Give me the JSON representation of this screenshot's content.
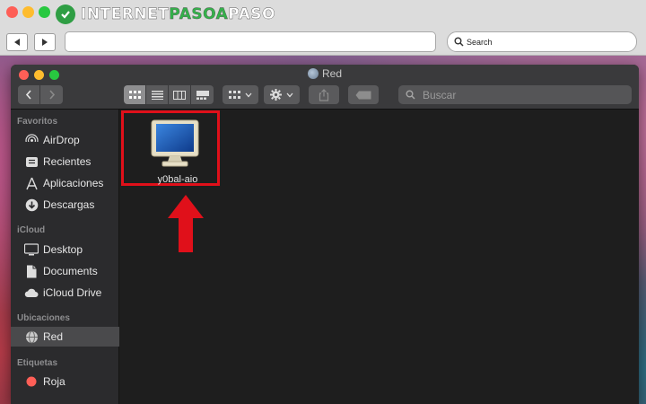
{
  "site": {
    "logo_internet": "INTERNET",
    "logo_paso_a": "PASOA",
    "logo_paso": "PASO"
  },
  "browser": {
    "url": "",
    "search_label": "Search",
    "back_icon": "back-arrow-icon",
    "forward_icon": "forward-arrow-icon"
  },
  "finder": {
    "title": "Red",
    "search_placeholder": "Buscar",
    "view_modes": [
      "icons",
      "list",
      "columns",
      "gallery"
    ],
    "active_view": "icons"
  },
  "sidebar": {
    "sections": [
      {
        "title": "Favoritos",
        "items": [
          {
            "label": "AirDrop",
            "icon": "airdrop-icon"
          },
          {
            "label": "Recientes",
            "icon": "clock-icon"
          },
          {
            "label": "Aplicaciones",
            "icon": "applications-icon"
          },
          {
            "label": "Descargas",
            "icon": "download-icon"
          }
        ]
      },
      {
        "title": "iCloud",
        "items": [
          {
            "label": "Desktop",
            "icon": "desktop-icon"
          },
          {
            "label": "Documents",
            "icon": "document-icon"
          },
          {
            "label": "iCloud Drive",
            "icon": "cloud-icon"
          }
        ]
      },
      {
        "title": "Ubicaciones",
        "items": [
          {
            "label": "Red",
            "icon": "network-globe-icon",
            "selected": true
          }
        ]
      },
      {
        "title": "Etiquetas",
        "items": [
          {
            "label": "Roja",
            "icon": "red-tag-icon"
          }
        ]
      }
    ]
  },
  "content": {
    "files": [
      {
        "name": "y0bal-aio",
        "icon": "computer-monitor-icon",
        "highlighted": true
      }
    ]
  },
  "colors": {
    "highlight": "#e0101a",
    "arrow": "#e0101a",
    "finder_bg": "#1e1e1e",
    "sidebar_bg": "#2b2b2d"
  }
}
